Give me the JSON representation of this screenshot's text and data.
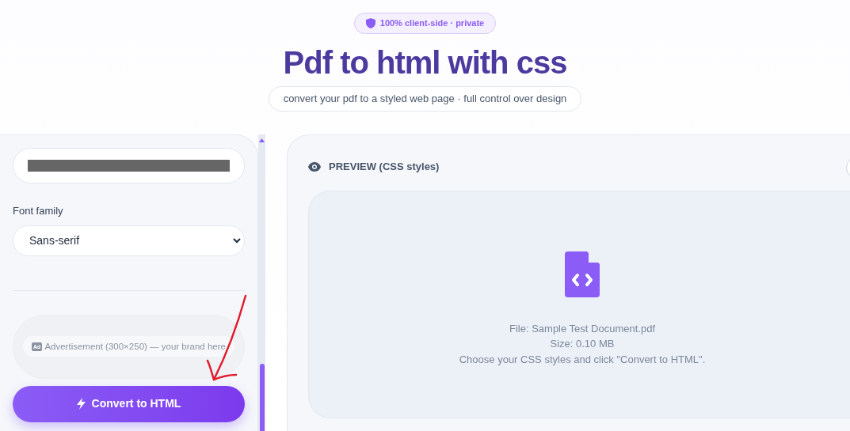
{
  "header": {
    "badge": "100% client-side · private",
    "title": "Pdf to html with css",
    "subtitle": "convert your pdf to a styled web page · full control over design"
  },
  "sidebar": {
    "text_color": {
      "color": "#666666"
    },
    "font_family": {
      "label": "Font family",
      "value": "Sans-serif"
    },
    "ad": {
      "icon_text": "Ad",
      "text": "Advertisement (300×250) — your brand here"
    },
    "convert_button": "Convert to HTML"
  },
  "preview": {
    "title": "PREVIEW (CSS styles)",
    "lines": [
      "File: Sample Test Document.pdf",
      "Size: 0.10 MB",
      "Choose your CSS styles and click \"Convert to HTML\"."
    ]
  }
}
